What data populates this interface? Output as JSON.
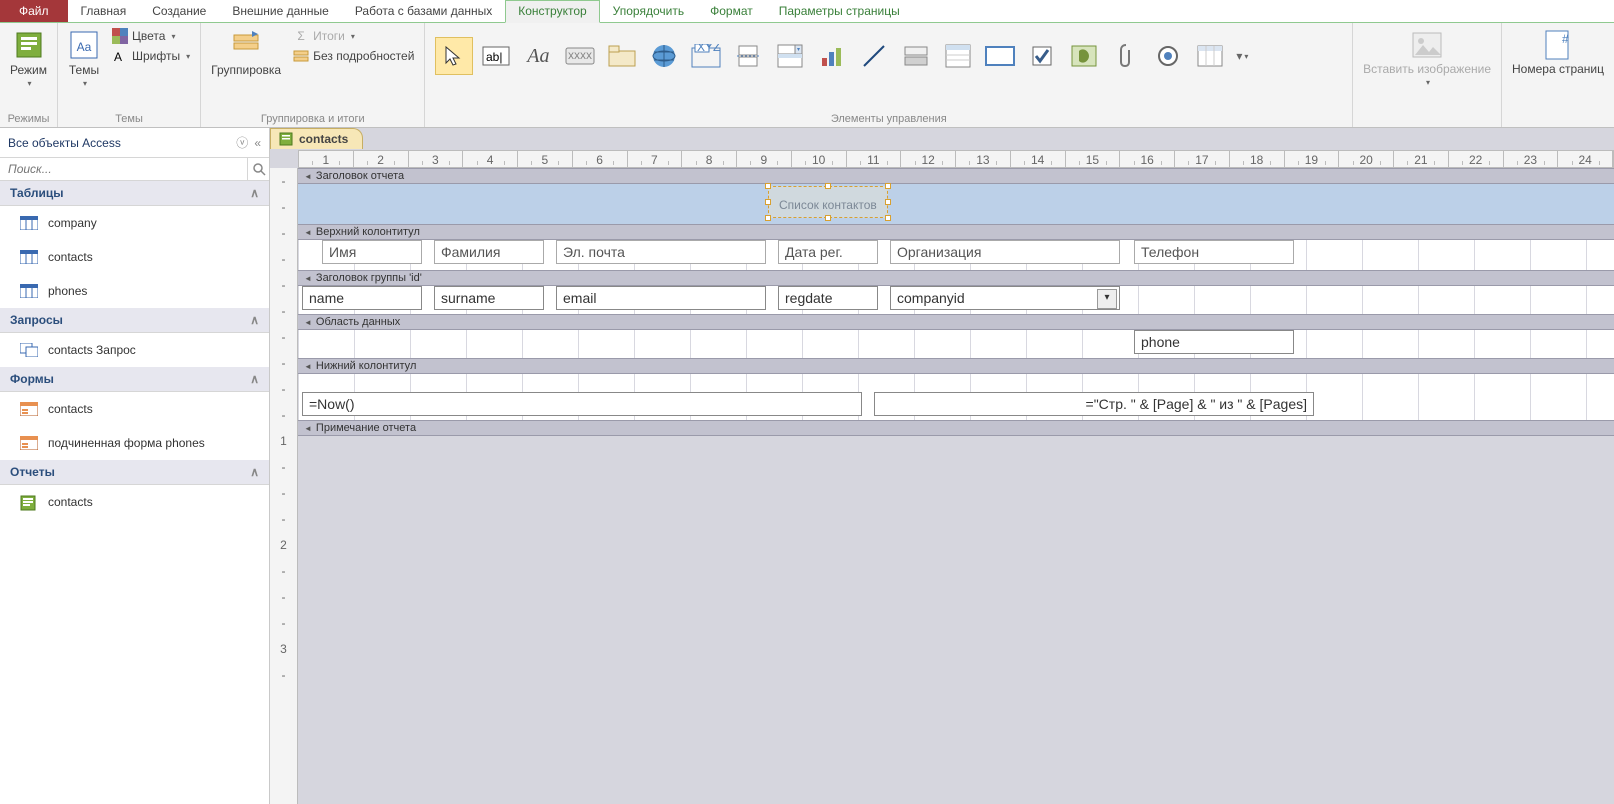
{
  "ribbon": {
    "tabs": [
      "Файл",
      "Главная",
      "Создание",
      "Внешние данные",
      "Работа с базами данных",
      "Конструктор",
      "Упорядочить",
      "Формат",
      "Параметры страницы"
    ],
    "active_index": 5,
    "groups": {
      "modes": {
        "label": "Режимы",
        "mode_btn": "Режим"
      },
      "themes": {
        "label": "Темы",
        "themes_btn": "Темы",
        "colors": "Цвета",
        "fonts": "Шрифты"
      },
      "grouping": {
        "label": "Группировка и итоги",
        "group_btn": "Группировка",
        "totals": "Итоги",
        "no_details": "Без подробностей"
      },
      "controls": {
        "label": "Элементы управления"
      },
      "image": {
        "insert_img": "Вставить изображение"
      },
      "pagenum": {
        "label": "Номера страниц"
      }
    }
  },
  "nav": {
    "title": "Все объекты Access",
    "search_placeholder": "Поиск...",
    "cats": [
      {
        "name": "Таблицы",
        "items": [
          "company",
          "contacts",
          "phones"
        ]
      },
      {
        "name": "Запросы",
        "items": [
          "contacts Запрос"
        ]
      },
      {
        "name": "Формы",
        "items": [
          "contacts",
          "подчиненная форма phones"
        ]
      },
      {
        "name": "Отчеты",
        "items": [
          "contacts"
        ]
      }
    ]
  },
  "doc": {
    "tab_name": "contacts",
    "sections": {
      "report_header": "Заголовок отчета",
      "page_header": "Верхний колонтитул",
      "group_header": "Заголовок группы 'id'",
      "detail": "Область данных",
      "page_footer": "Нижний колонтитул",
      "report_footer": "Примечание отчета"
    },
    "title_label": "Список контактов",
    "col_labels": {
      "name": "Имя",
      "surname": "Фамилия",
      "email": "Эл. почта",
      "regdate": "Дата рег.",
      "company": "Организация",
      "phone": "Телефон"
    },
    "fields": {
      "name": "name",
      "surname": "surname",
      "email": "email",
      "regdate": "regdate",
      "companyid": "companyid",
      "phone": "phone"
    },
    "footer": {
      "now": "=Now()",
      "pages": "=\"Стр. \" & [Page] & \" из \" & [Pages]"
    }
  },
  "ruler_max": 24
}
